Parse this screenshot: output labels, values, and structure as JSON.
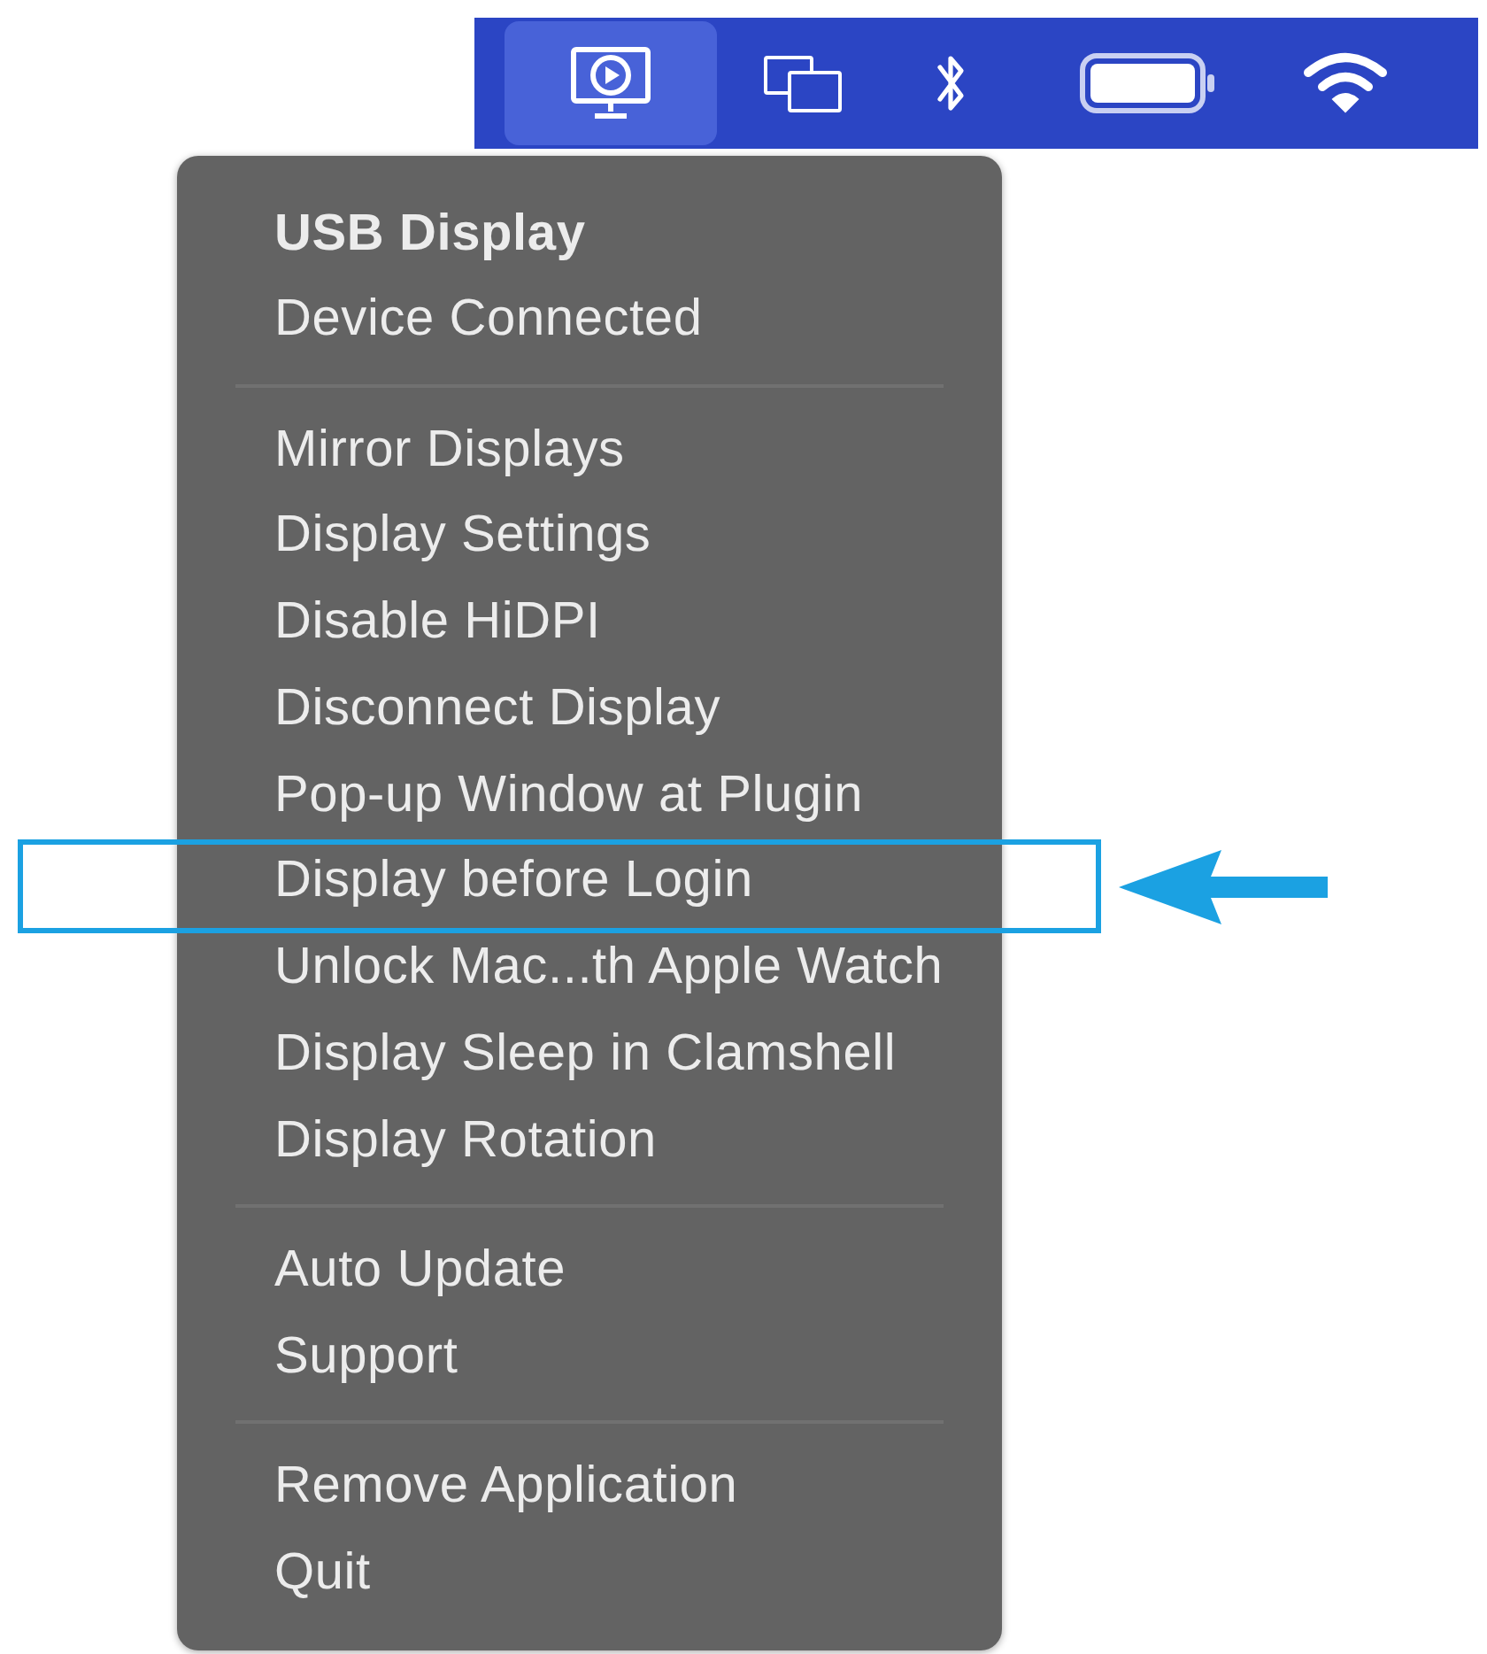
{
  "menubar": {
    "icons": [
      {
        "kind": "display-app",
        "selected": true
      },
      {
        "kind": "screens",
        "selected": false
      },
      {
        "kind": "bluetooth",
        "selected": false
      },
      {
        "kind": "battery",
        "selected": false
      },
      {
        "kind": "wifi",
        "selected": false
      }
    ]
  },
  "menu": {
    "sections": [
      {
        "items": [
          {
            "kind": "title",
            "text": "USB Display",
            "annotated": false
          },
          {
            "kind": "status",
            "text": "Device Connected",
            "annotated": false
          }
        ]
      },
      {
        "items": [
          {
            "kind": "action",
            "text": "Mirror Displays",
            "annotated": false
          },
          {
            "kind": "action",
            "text": "Display Settings",
            "annotated": false
          },
          {
            "kind": "action",
            "text": "Disable HiDPI",
            "annotated": false
          },
          {
            "kind": "action",
            "text": "Disconnect Display",
            "annotated": false
          },
          {
            "kind": "action",
            "text": "Pop-up Window at Plugin",
            "annotated": false
          },
          {
            "kind": "action",
            "text": "Display before Login",
            "annotated": true
          },
          {
            "kind": "action",
            "text": "Unlock Mac...th Apple Watch",
            "annotated": false
          },
          {
            "kind": "action",
            "text": "Display Sleep in Clamshell",
            "annotated": false
          },
          {
            "kind": "action",
            "text": "Display Rotation",
            "annotated": false
          }
        ]
      },
      {
        "items": [
          {
            "kind": "action",
            "text": "Auto Update",
            "annotated": false
          },
          {
            "kind": "action",
            "text": "Support",
            "annotated": false
          }
        ]
      },
      {
        "items": [
          {
            "kind": "action",
            "text": "Remove Application",
            "annotated": false
          },
          {
            "kind": "action",
            "text": "Quit",
            "annotated": false
          }
        ]
      }
    ]
  }
}
